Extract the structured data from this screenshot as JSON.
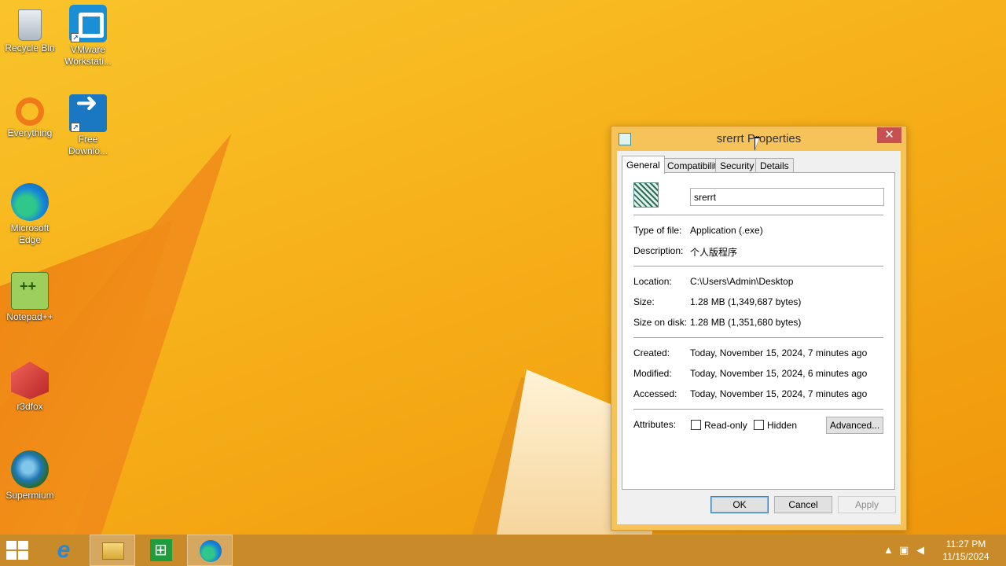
{
  "desktop": {
    "icons": [
      {
        "label": "Recycle Bin",
        "icon": "recycle-bin-icon"
      },
      {
        "label": "VMware Workstati...",
        "icon": "vmware-icon"
      },
      {
        "label": "Everything",
        "icon": "everything-icon"
      },
      {
        "label": "Free Downlo...",
        "icon": "free-download-manager-icon"
      },
      {
        "label": "Microsoft Edge",
        "icon": "edge-icon"
      },
      {
        "label": "Notepad++",
        "icon": "notepad-plus-plus-icon"
      },
      {
        "label": "r3dfox",
        "icon": "r3dfox-icon"
      },
      {
        "label": "Supermium",
        "icon": "supermium-icon"
      }
    ]
  },
  "dialog": {
    "title": "srerrt Properties",
    "close_glyph": "✕",
    "tabs": [
      {
        "label": "General",
        "active": true
      },
      {
        "label": "Compatibility",
        "active": false
      },
      {
        "label": "Security",
        "active": false
      },
      {
        "label": "Details",
        "active": false
      }
    ],
    "file_name": "srerrt",
    "rows": {
      "type_label": "Type of file:",
      "type_value": "Application (.exe)",
      "description_label": "Description:",
      "description_value": "个人版程序",
      "location_label": "Location:",
      "location_value": "C:\\Users\\Admin\\Desktop",
      "size_label": "Size:",
      "size_value": "1.28 MB (1,349,687 bytes)",
      "size_on_disk_label": "Size on disk:",
      "size_on_disk_value": "1.28 MB (1,351,680 bytes)",
      "created_label": "Created:",
      "created_value": "Today, November 15, 2024, 7 minutes ago",
      "modified_label": "Modified:",
      "modified_value": "Today, November 15, 2024, 6 minutes ago",
      "accessed_label": "Accessed:",
      "accessed_value": "Today, November 15, 2024, 7 minutes ago",
      "attributes_label": "Attributes:"
    },
    "attributes": {
      "readonly_label": "Read-only",
      "readonly_checked": false,
      "hidden_label": "Hidden",
      "hidden_checked": false,
      "advanced_label": "Advanced..."
    },
    "buttons": {
      "ok": "OK",
      "cancel": "Cancel",
      "apply": "Apply",
      "apply_enabled": false
    }
  },
  "taskbar": {
    "items": [
      {
        "icon": "start-icon"
      },
      {
        "icon": "internet-explorer-icon"
      },
      {
        "icon": "file-explorer-icon",
        "active": true
      },
      {
        "icon": "store-icon"
      },
      {
        "icon": "edge-icon",
        "active": true
      }
    ],
    "clock": {
      "time": "11:27 PM",
      "date": "11/15/2024"
    }
  },
  "colors": {
    "desktop_bg": "#f7b21b",
    "dialog_frame": "#f6c35a",
    "close_button": "#c75050",
    "taskbar": "#c98b2a"
  }
}
